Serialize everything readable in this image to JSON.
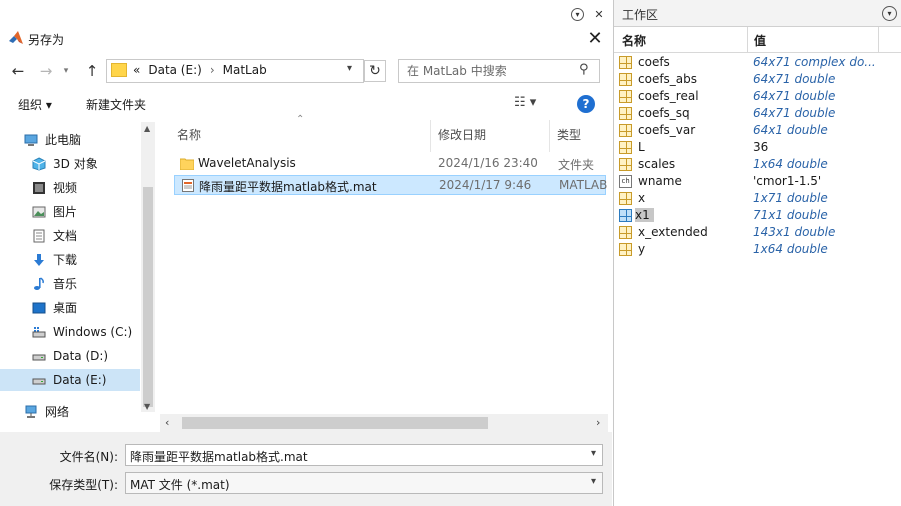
{
  "dialog": {
    "title": "另存为",
    "close_label": "✕",
    "nav": {
      "breadcrumb": [
        "«",
        "Data (E:)",
        "MatLab"
      ],
      "search_placeholder": "在 MatLab 中搜索"
    },
    "toolbar": {
      "organize_label": "组织 ▾",
      "new_folder_label": "新建文件夹",
      "view_label": "☷ ▾",
      "help_label": "?"
    },
    "navpane": {
      "items": [
        {
          "label": "此电脑",
          "icon": "computer-icon"
        },
        {
          "label": "3D 对象",
          "icon": "3d-objects-icon"
        },
        {
          "label": "视频",
          "icon": "video-icon"
        },
        {
          "label": "图片",
          "icon": "pictures-icon"
        },
        {
          "label": "文档",
          "icon": "documents-icon"
        },
        {
          "label": "下载",
          "icon": "download-icon"
        },
        {
          "label": "音乐",
          "icon": "music-icon"
        },
        {
          "label": "桌面",
          "icon": "desktop-icon"
        },
        {
          "label": "Windows (C:)",
          "icon": "drive-icon"
        },
        {
          "label": "Data (D:)",
          "icon": "drive-icon"
        },
        {
          "label": "Data (E:)",
          "icon": "drive-icon"
        },
        {
          "label": "网络",
          "icon": "network-icon"
        }
      ]
    },
    "filelist": {
      "columns": [
        "名称",
        "修改日期",
        "类型"
      ],
      "rows": [
        {
          "name": "WaveletAnalysis",
          "date": "2024/1/16 23:40",
          "type": "文件夹",
          "icon": "folder-icon"
        },
        {
          "name": "降雨量距平数据matlab格式.mat",
          "date": "2024/1/17 9:46",
          "type": "MATLAB",
          "icon": "mat-file-icon"
        }
      ]
    },
    "form": {
      "filename_label": "文件名(N):",
      "filename_value": "降雨量距平数据matlab格式.mat",
      "filetype_label": "保存类型(T):",
      "filetype_value": "MAT 文件 (*.mat)"
    }
  },
  "workspace": {
    "title": "工作区",
    "columns": [
      "名称",
      "值"
    ],
    "variables": [
      {
        "name": "coefs",
        "value": "64x71 complex do...",
        "icon": "grid-icon"
      },
      {
        "name": "coefs_abs",
        "value": "64x71 double",
        "icon": "grid-icon"
      },
      {
        "name": "coefs_real",
        "value": "64x71 double",
        "icon": "grid-icon"
      },
      {
        "name": "coefs_sq",
        "value": "64x71 double",
        "icon": "grid-icon"
      },
      {
        "name": "coefs_var",
        "value": "64x1 double",
        "icon": "grid-icon"
      },
      {
        "name": "L",
        "value": "36",
        "icon": "grid-icon"
      },
      {
        "name": "scales",
        "value": "1x64 double",
        "icon": "grid-icon"
      },
      {
        "name": "wname",
        "value": "'cmor1-1.5'",
        "icon": "char-icon"
      },
      {
        "name": "x",
        "value": "1x71 double",
        "icon": "grid-icon"
      },
      {
        "name": "x1",
        "value": "71x1 double",
        "icon": "grid-icon"
      },
      {
        "name": "x_extended",
        "value": "143x1 double",
        "icon": "grid-icon"
      },
      {
        "name": "y",
        "value": "1x64 double",
        "icon": "grid-icon"
      }
    ]
  }
}
